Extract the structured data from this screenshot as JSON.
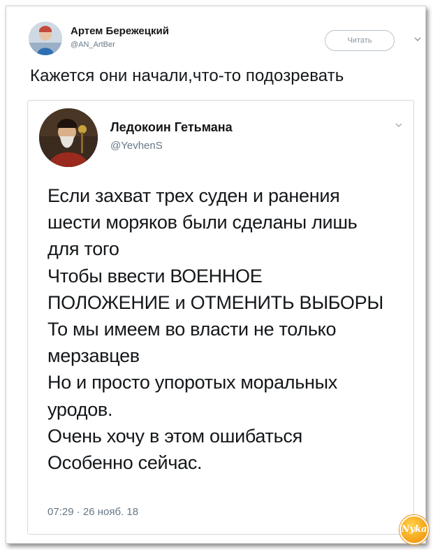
{
  "outer_tweet": {
    "author_name": "Артем Бережецкий",
    "author_handle": "@AN_ArtBer",
    "follow_label": "Читать",
    "text": "Кажется они начали,что-то подозревать"
  },
  "quoted_tweet": {
    "author_name": "Ледокоин Гетьмана",
    "author_handle": "@YevhenS",
    "text": "Если захват трех суден и ранения\nшести моряков были сделаны лишь\nдля того\nЧтобы ввести ВОЕННОЕ\nПОЛОЖЕНИЕ и ОТМЕНИТЬ ВЫБОРЫ\nТо мы имеем во власти не только\nмерзавцев\nНо и просто упоротых моральных\nуродов.\nОчень хочу в этом ошибаться\nОсобенно сейчас.",
    "timestamp": "07:29 · 26 нояб. 18"
  },
  "watermark": {
    "text": "Nyka"
  },
  "colors": {
    "text": "#14171a",
    "secondary": "#657786",
    "border": "#d4d9de",
    "watermark": "#f08a00"
  },
  "icons": {
    "outer_menu": "chevron-down-icon",
    "quote_menu": "chevron-down-icon"
  }
}
